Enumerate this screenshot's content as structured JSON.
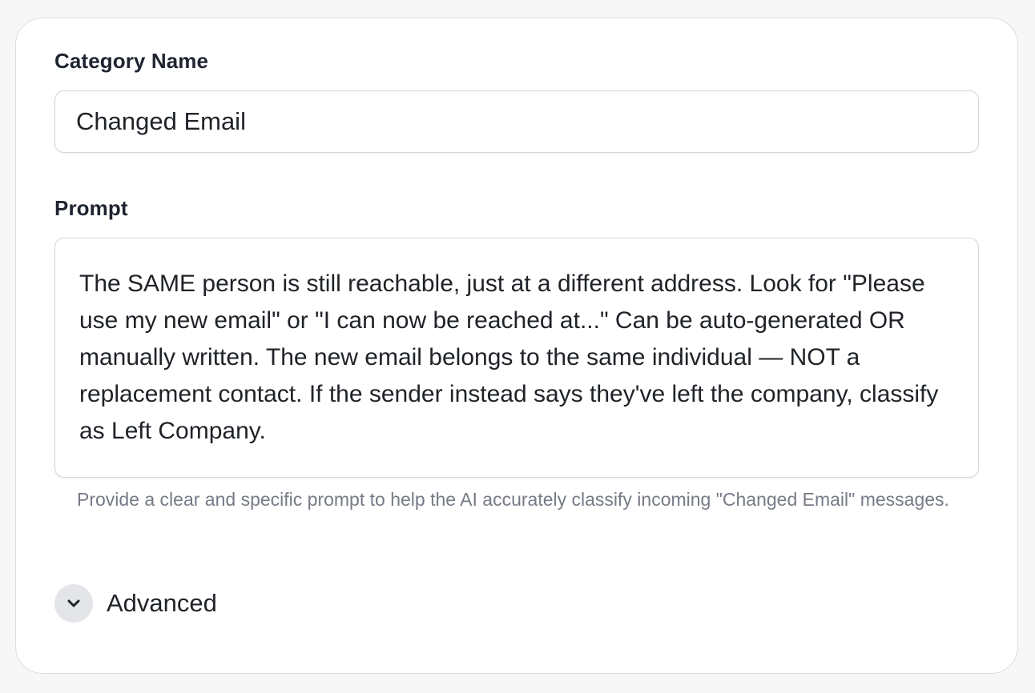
{
  "form": {
    "category_name": {
      "label": "Category Name",
      "value": "Changed Email"
    },
    "prompt": {
      "label": "Prompt",
      "value": "The SAME person is still reachable, just at a different address. Look for \"Please use my new email\" or \"I can now be reached at...\" Can be auto-generated OR manually written. The new email belongs to the same individual — NOT a replacement contact. If the sender instead says they've left the company, classify as Left Company.",
      "helper": "Provide a clear and specific prompt to help the AI accurately classify incoming \"Changed Email\" messages."
    },
    "advanced": {
      "label": "Advanced",
      "icon": "chevron-down-icon",
      "expanded": false
    }
  },
  "colors": {
    "card_background": "#ffffff",
    "page_background": "#f7f7f7",
    "border": "#d4d6db",
    "helper_text": "#767b86",
    "chevron_circle": "#e4e5e9"
  }
}
